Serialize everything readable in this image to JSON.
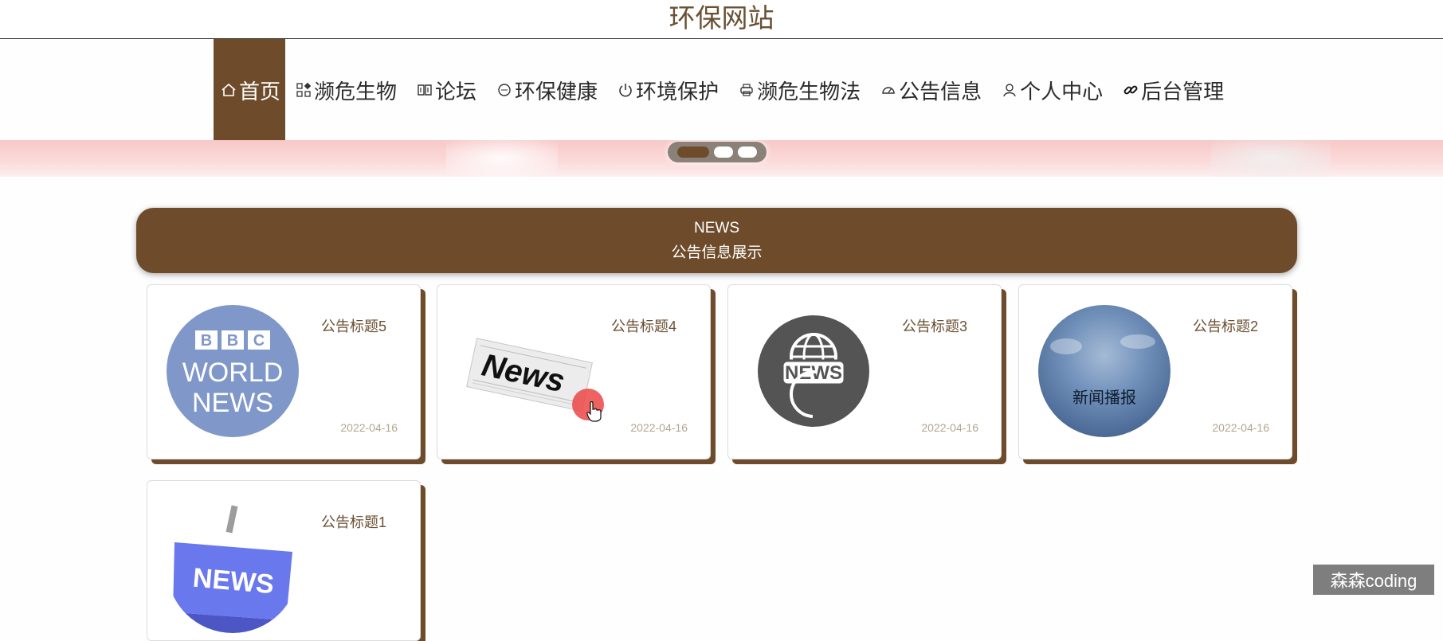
{
  "site": {
    "title": "环保网站"
  },
  "nav": [
    {
      "label": "首页",
      "icon": "home-icon",
      "active": true
    },
    {
      "label": "濒危生物",
      "icon": "grid-icon"
    },
    {
      "label": "论坛",
      "icon": "book-icon"
    },
    {
      "label": "环保健康",
      "icon": "circle-icon"
    },
    {
      "label": "环境保护",
      "icon": "power-icon"
    },
    {
      "label": "濒危生物法",
      "icon": "printer-icon"
    },
    {
      "label": "公告信息",
      "icon": "gauge-icon"
    },
    {
      "label": "个人中心",
      "icon": "user-icon"
    },
    {
      "label": "后台管理",
      "icon": "link-icon"
    }
  ],
  "carousel": {
    "slide_count": 3,
    "active_index": 0
  },
  "news_section": {
    "en": "NEWS",
    "zh": "公告信息展示"
  },
  "cards": [
    {
      "title": "公告标题5",
      "date": "2022-04-16",
      "image": "bbc-world-news-image"
    },
    {
      "title": "公告标题4",
      "date": "2022-04-16",
      "image": "newspaper-image"
    },
    {
      "title": "公告标题3",
      "date": "2022-04-16",
      "image": "globe-news-image"
    },
    {
      "title": "公告标题2",
      "date": "2022-04-16",
      "image": "news-broadcast-image",
      "image_text": "新闻播报"
    },
    {
      "title": "公告标题1",
      "date": "",
      "image": "news-tv-image"
    }
  ],
  "bbc_logo": {
    "letters": [
      "B",
      "B",
      "C"
    ],
    "line1": "WORLD",
    "line2": "NEWS"
  },
  "newspaper_logo": "News",
  "globe_logo": "NEWS",
  "tv_logo": "NEWS",
  "watermark": "森森coding",
  "colors": {
    "primary": "#6e4c2b",
    "banner": "#f8c8c8",
    "text_title": "#6b5033"
  }
}
